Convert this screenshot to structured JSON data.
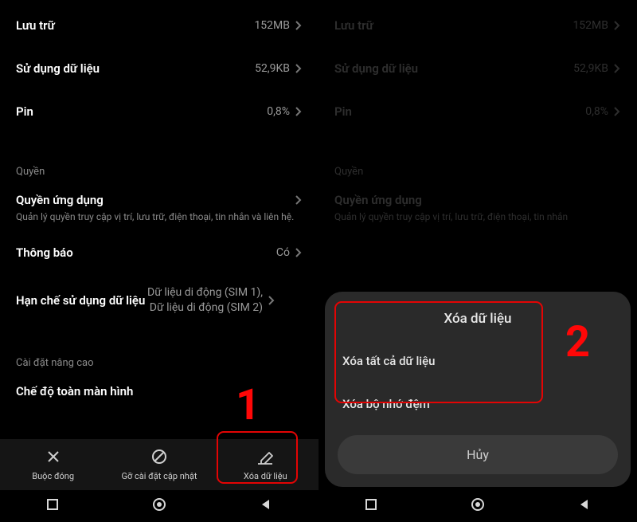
{
  "left": {
    "storage": {
      "label": "Lưu trữ",
      "value": "152MB"
    },
    "data_usage": {
      "label": "Sử dụng dữ liệu",
      "value": "52,9KB"
    },
    "battery": {
      "label": "Pin",
      "value": "0,8%"
    },
    "perm_section": "Quyền",
    "app_perm": {
      "label": "Quyền ứng dụng",
      "desc": "Quản lý quyền truy cập vị trí, lưu trữ, điện thoại, tin nhắn và liên hệ."
    },
    "notifications": {
      "label": "Thông báo",
      "value": "Có"
    },
    "restrict": {
      "label": "Hạn chế sử dụng dữ liệu",
      "value1": "Dữ liệu di động (SIM 1),",
      "value2": "Dữ liệu di động (SIM 2)"
    },
    "advanced_section": "Cài đặt nâng cao",
    "fullscreen": {
      "label": "Chế độ toàn màn hình"
    },
    "bottom": {
      "force_stop": "Buộc đóng",
      "uninstall_updates": "Gỡ cài đặt cập nhật",
      "clear_data": "Xóa dữ liệu"
    },
    "step": "1"
  },
  "right": {
    "storage": {
      "label": "Lưu trữ",
      "value": "152MB"
    },
    "data_usage": {
      "label": "Sử dụng dữ liệu",
      "value": "52,9KB"
    },
    "battery": {
      "label": "Pin",
      "value": "0,8%"
    },
    "perm_section": "Quyền",
    "app_perm": {
      "label": "Quyền ứng dụng",
      "desc": "Quản lý quyền truy cập vị trí, lưu trữ, điện thoại, tin nhắn"
    },
    "sheet": {
      "title": "Xóa dữ liệu",
      "opt1": "Xóa tất cả dữ liệu",
      "opt2": "Xóa bộ nhớ đệm",
      "cancel": "Hủy"
    },
    "step": "2"
  }
}
